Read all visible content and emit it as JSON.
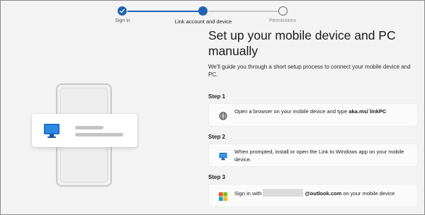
{
  "stepper": {
    "steps": [
      {
        "label": "Sign in",
        "state": "done"
      },
      {
        "label": "Link account and device",
        "state": "current"
      },
      {
        "label": "Permissions",
        "state": "todo"
      }
    ]
  },
  "main": {
    "title": "Set up your mobile device and PC manually",
    "subtitle": "We'll guide you through a short setup process to connect your mobile device and PC.",
    "steps": [
      {
        "heading": "Step 1",
        "icon": "globe-icon",
        "text_before": "Open a browser on your mobile device and type ",
        "text_strong": "aka.ms/ linkPC",
        "text_after": ""
      },
      {
        "heading": "Step 2",
        "icon": "link-to-windows-icon",
        "text": "When prompted, install or open the Link to Windows app on your mobile device."
      },
      {
        "heading": "Step 3",
        "icon": "microsoft-logo-icon",
        "text_before": "Sign in with",
        "text_strong": "@outlook.com",
        "text_after": " on your mobile device"
      }
    ]
  },
  "colors": {
    "accent": "#1f63b5",
    "background": "#f3f3f3",
    "card": "#fbfbfb"
  }
}
